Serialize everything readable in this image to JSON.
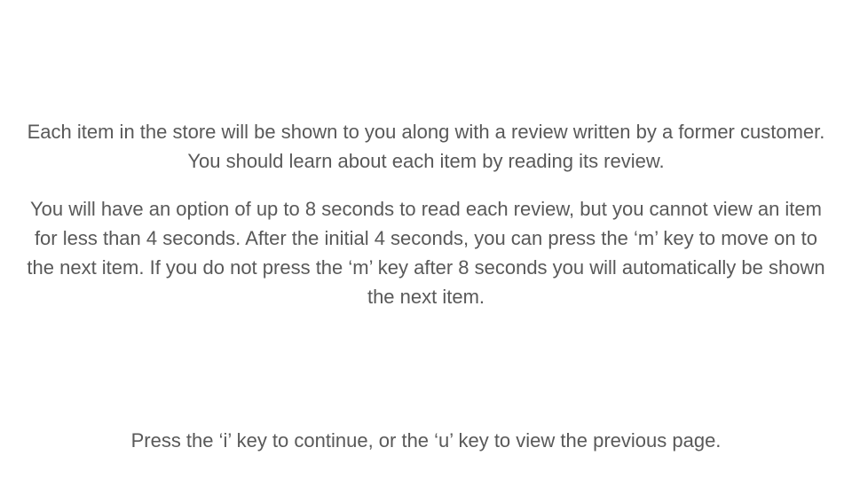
{
  "instructions": {
    "paragraph_1": "Each item in the store will be shown to you along with a review written by a former customer. You should learn about each item by reading its review.",
    "paragraph_2": "You will have an option of up to 8 seconds to read each review, but you cannot view an item for less than 4 seconds. After the initial 4 seconds, you can press the ‘m’ key to move on to the next item. If you do not press the ‘m’ key after 8 seconds you will automatically be shown the next item."
  },
  "footer": {
    "prompt": "Press the ‘i’ key to continue, or the ‘u’ key to view the previous page."
  },
  "colors": {
    "background": "#ffffff",
    "text": "#595959"
  }
}
